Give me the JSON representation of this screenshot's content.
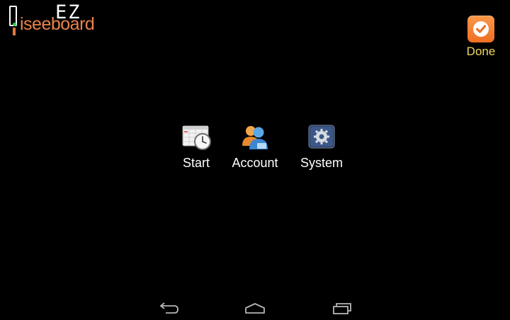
{
  "logo": {
    "ez_text": "EZ",
    "brand_text": "iseeboard"
  },
  "done_button": {
    "label": "Done",
    "icon": "checkmark-icon"
  },
  "menu": {
    "items": [
      {
        "label": "Start",
        "icon": "calendar-clock-icon"
      },
      {
        "label": "Account",
        "icon": "users-icon"
      },
      {
        "label": "System",
        "icon": "settings-gear-icon"
      }
    ]
  },
  "nav": {
    "buttons": [
      "back-icon",
      "home-icon",
      "recent-apps-icon"
    ]
  },
  "colors": {
    "background": "#000000",
    "brand_orange": "#e9834a",
    "done_label": "#f3d75c",
    "done_button": "#f27a2c"
  }
}
